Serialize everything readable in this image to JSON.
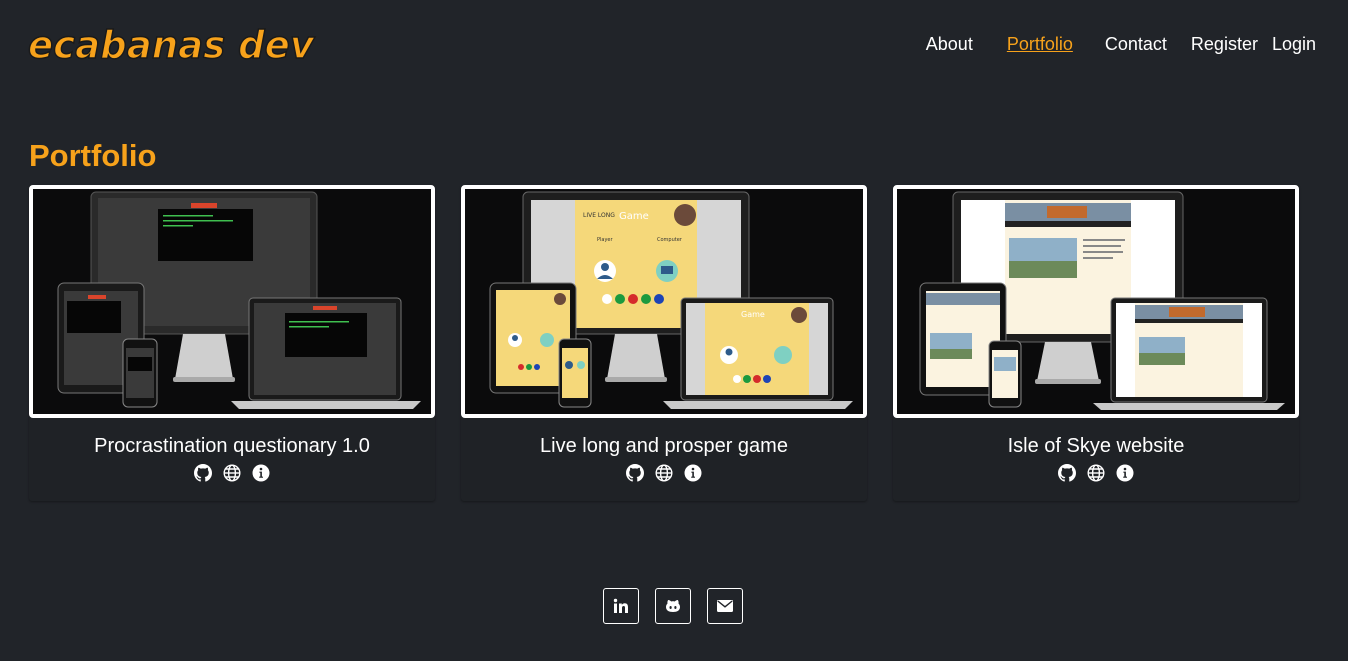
{
  "header": {
    "logo_text": "ecabanas dev",
    "nav": [
      {
        "label": "About",
        "active": false
      },
      {
        "label": "Portfolio",
        "active": true
      },
      {
        "label": "Contact",
        "active": false
      },
      {
        "label": "Register",
        "active": false
      },
      {
        "label": "Login",
        "active": false
      }
    ]
  },
  "main": {
    "title": "Portfolio",
    "projects": [
      {
        "title": "Procrastination questionary 1.0",
        "icons": [
          "github-icon",
          "globe-icon",
          "info-icon"
        ]
      },
      {
        "title": "Live long and prosper game",
        "icons": [
          "github-icon",
          "globe-icon",
          "info-icon"
        ]
      },
      {
        "title": "Isle of Skye website",
        "icons": [
          "github-icon",
          "globe-icon",
          "info-icon"
        ]
      }
    ]
  },
  "footer": {
    "social": [
      "linkedin-icon",
      "github-icon",
      "envelope-icon"
    ]
  },
  "colors": {
    "background": "#212429",
    "accent": "#f7a21b",
    "text": "#ffffff"
  }
}
